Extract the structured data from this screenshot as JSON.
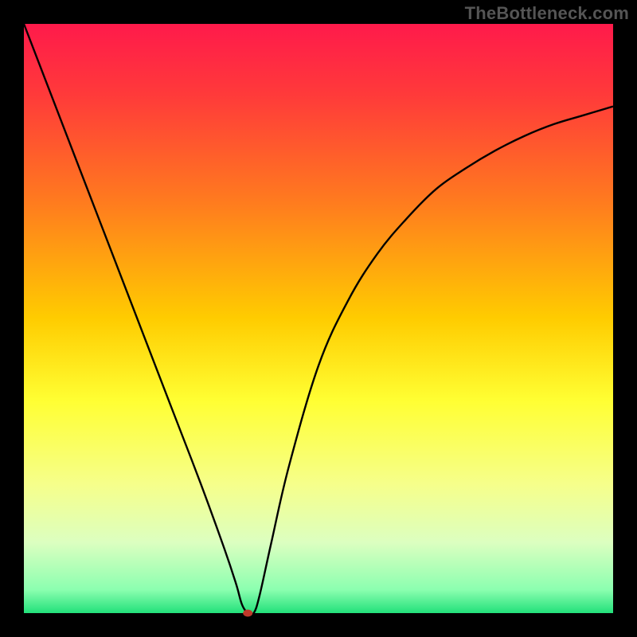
{
  "watermark": "TheBottleneck.com",
  "colors": {
    "frame": "#000000",
    "curve": "#000000",
    "dot": "#c04a3a",
    "gradient_stops": [
      {
        "pct": 0,
        "color": "#ff1a4b"
      },
      {
        "pct": 12,
        "color": "#ff3a3a"
      },
      {
        "pct": 30,
        "color": "#ff7a1f"
      },
      {
        "pct": 50,
        "color": "#ffcc00"
      },
      {
        "pct": 64,
        "color": "#ffff33"
      },
      {
        "pct": 78,
        "color": "#f6ff8a"
      },
      {
        "pct": 88,
        "color": "#dcffc0"
      },
      {
        "pct": 96,
        "color": "#8cffb0"
      },
      {
        "pct": 100,
        "color": "#22e07a"
      }
    ]
  },
  "chart_data": {
    "type": "line",
    "title": "",
    "xlabel": "",
    "ylabel": "",
    "xlim": [
      0,
      100
    ],
    "ylim": [
      0,
      100
    ],
    "min_point": {
      "x": 38,
      "y": 0
    },
    "series": [
      {
        "name": "bottleneck-curve",
        "x": [
          0,
          5,
          10,
          15,
          20,
          25,
          30,
          34,
          36,
          37,
          38,
          39,
          40,
          42,
          45,
          50,
          55,
          60,
          65,
          70,
          75,
          80,
          85,
          90,
          95,
          100
        ],
        "values": [
          100,
          87,
          74,
          61,
          48,
          35,
          22,
          11,
          5,
          1.5,
          0,
          0,
          3,
          12,
          25,
          42,
          53,
          61,
          67,
          72,
          75.5,
          78.5,
          81,
          83,
          84.5,
          86
        ]
      }
    ]
  }
}
